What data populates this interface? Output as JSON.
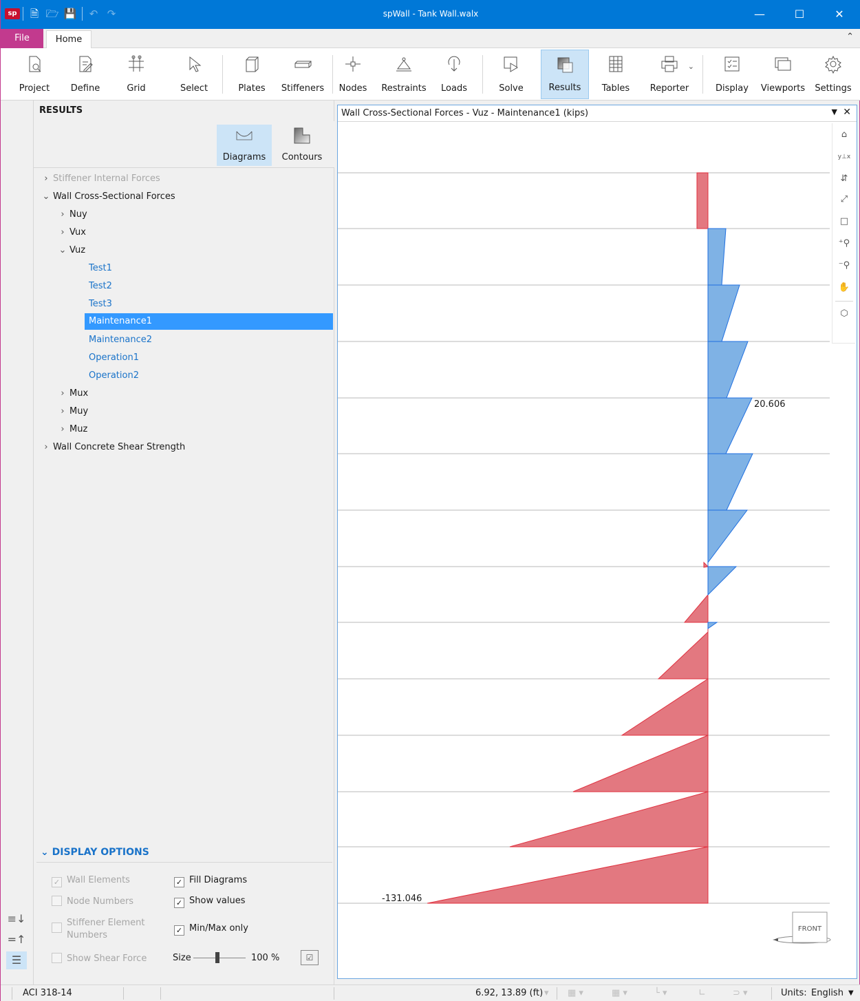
{
  "window": {
    "title": "spWall - Tank Wall.walx",
    "logo": "sp",
    "qat_icons": [
      "new-file-icon",
      "open-folder-icon",
      "save-icon",
      "undo-icon",
      "redo-icon"
    ]
  },
  "menu": {
    "file": "File",
    "home": "Home"
  },
  "ribbon": {
    "buttons": [
      {
        "label": "Project",
        "icon": "project-icon"
      },
      {
        "label": "Define",
        "icon": "define-icon"
      },
      {
        "label": "Grid",
        "icon": "grid-icon"
      },
      {
        "label": "Select",
        "icon": "cursor-icon"
      },
      {
        "label": "Plates",
        "icon": "plate-icon"
      },
      {
        "label": "Stiffeners",
        "icon": "stiffener-icon"
      },
      {
        "label": "Nodes",
        "icon": "node-icon"
      },
      {
        "label": "Restraints",
        "icon": "restraint-icon"
      },
      {
        "label": "Loads",
        "icon": "load-icon"
      },
      {
        "label": "Solve",
        "icon": "solve-icon"
      },
      {
        "label": "Results",
        "icon": "results-icon",
        "active": true
      },
      {
        "label": "Tables",
        "icon": "table-icon"
      },
      {
        "label": "Reporter",
        "icon": "printer-icon"
      },
      {
        "label": "Display",
        "icon": "display-icon"
      },
      {
        "label": "Viewports",
        "icon": "viewports-icon"
      },
      {
        "label": "Settings",
        "icon": "gear-icon"
      }
    ]
  },
  "panel": {
    "title": "RESULTS",
    "views": [
      {
        "label": "Diagrams",
        "active": true
      },
      {
        "label": "Contours",
        "active": false
      }
    ],
    "tree": [
      {
        "label": "Stiffener Internal Forces",
        "level": 0,
        "expanded": false,
        "dim": true
      },
      {
        "label": "Wall Cross-Sectional Forces",
        "level": 0,
        "expanded": true
      },
      {
        "label": "Nuy",
        "level": 1,
        "expanded": false
      },
      {
        "label": "Vux",
        "level": 1,
        "expanded": false
      },
      {
        "label": "Vuz",
        "level": 1,
        "expanded": true
      },
      {
        "label": "Test1",
        "level": 2,
        "leaf": true
      },
      {
        "label": "Test2",
        "level": 2,
        "leaf": true
      },
      {
        "label": "Test3",
        "level": 2,
        "leaf": true
      },
      {
        "label": "Maintenance1",
        "level": 2,
        "leaf": true,
        "selected": true
      },
      {
        "label": "Maintenance2",
        "level": 2,
        "leaf": true
      },
      {
        "label": "Operation1",
        "level": 2,
        "leaf": true
      },
      {
        "label": "Operation2",
        "level": 2,
        "leaf": true
      },
      {
        "label": "Mux",
        "level": 1,
        "expanded": false
      },
      {
        "label": "Muy",
        "level": 1,
        "expanded": false
      },
      {
        "label": "Muz",
        "level": 1,
        "expanded": false
      },
      {
        "label": "Wall Concrete Shear Strength",
        "level": 0,
        "expanded": false
      }
    ],
    "display_options": {
      "title": "DISPLAY OPTIONS",
      "wall_elements": "Wall Elements",
      "node_numbers": "Node Numbers",
      "stiffener_numbers_1": "Stiffener Element",
      "stiffener_numbers_2": "Numbers",
      "show_shear_force": "Show Shear Force",
      "fill_diagrams": "Fill Diagrams",
      "show_values": "Show values",
      "min_max_only": "Min/Max only",
      "size_label": "Size",
      "size_value": "100 %",
      "size_fraction": 0.5
    }
  },
  "viewport": {
    "title": "Wall Cross-Sectional Forces - Vuz - Maintenance1 (kips)",
    "max_label": "20.606",
    "min_label": "-131.046",
    "cube_label": "FRONT",
    "positive_color": "#7fb2e5",
    "negative_color": "#e37880"
  },
  "status": {
    "code": "ACI 318-14",
    "coords": "6.92, 13.89 (ft)",
    "units_label": "Units:",
    "units_value": "English"
  }
}
